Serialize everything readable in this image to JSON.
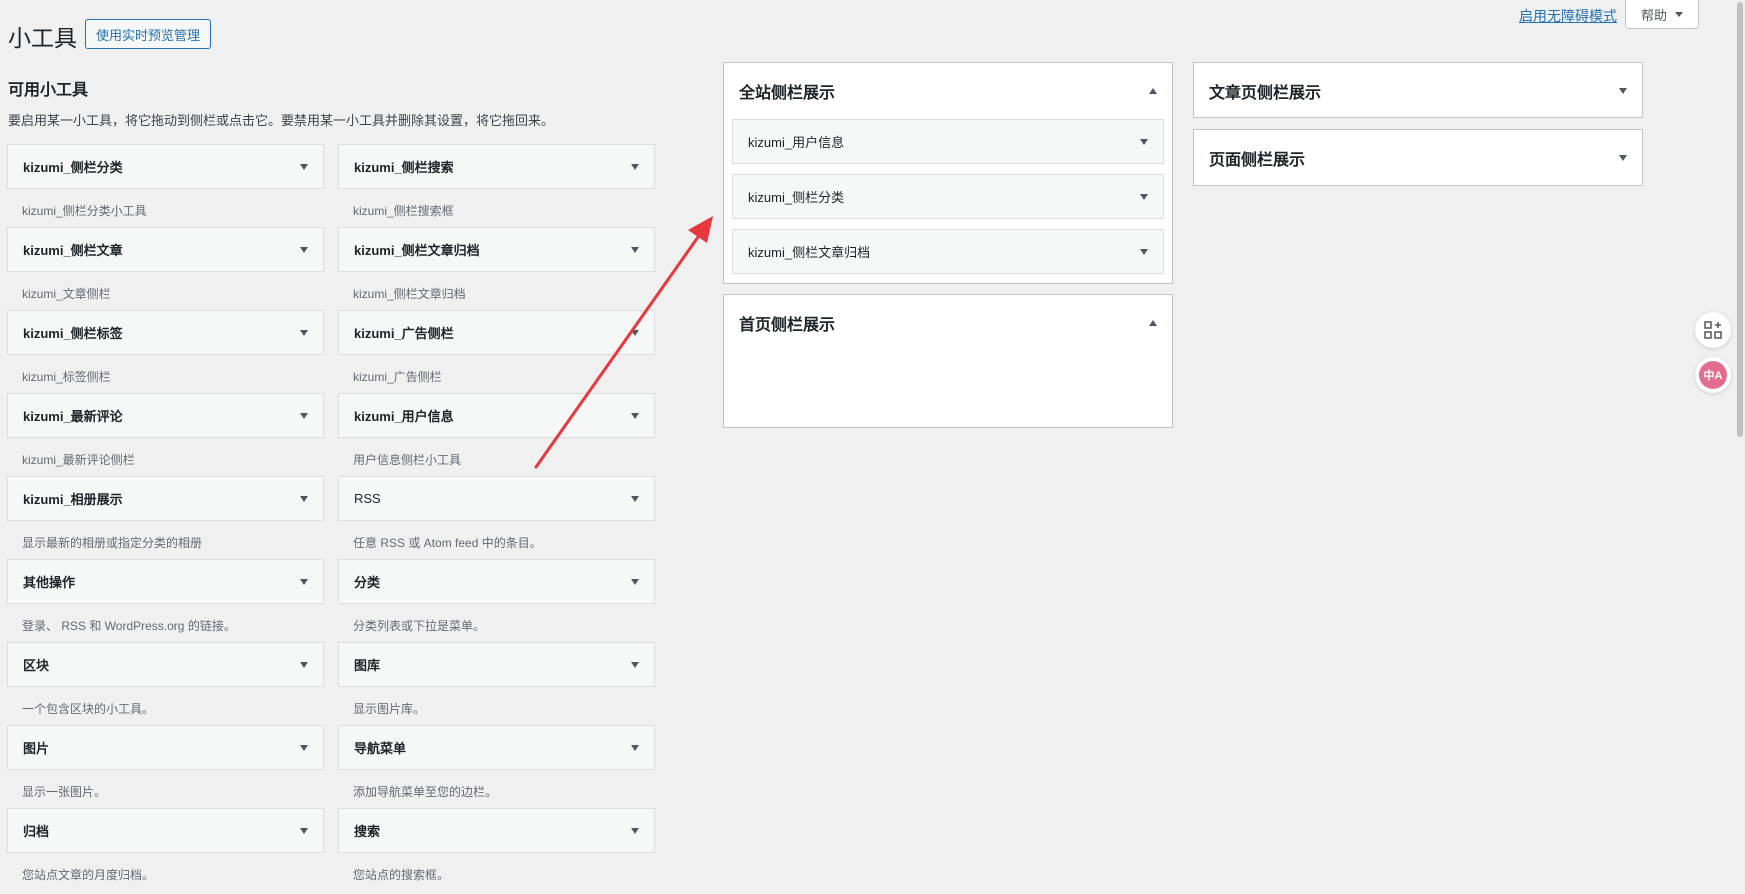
{
  "header": {
    "title": "小工具",
    "live_preview_button": "使用实时预览管理",
    "accessibility_link": "启用无障碍模式",
    "help_button": "帮助"
  },
  "available": {
    "title": "可用小工具",
    "description": "要启用某一小工具，将它拖动到侧栏或点击它。要禁用某一小工具并删除其设置，将它拖回来。",
    "widgets": [
      {
        "label": "kizumi_侧栏分类",
        "desc": "kizumi_侧栏分类小工具"
      },
      {
        "label": "kizumi_侧栏搜索",
        "desc": "kizumi_侧栏搜索框"
      },
      {
        "label": "kizumi_侧栏文章",
        "desc": "kizumi_文章侧栏"
      },
      {
        "label": "kizumi_侧栏文章归档",
        "desc": "kizumi_侧栏文章归档"
      },
      {
        "label": "kizumi_侧栏标签",
        "desc": "kizumi_标签侧栏"
      },
      {
        "label": "kizumi_广告侧栏",
        "desc": "kizumi_广告侧栏"
      },
      {
        "label": "kizumi_最新评论",
        "desc": "kizumi_最新评论侧栏"
      },
      {
        "label": "kizumi_用户信息",
        "desc": "用户信息侧栏小工具"
      },
      {
        "label": "kizumi_相册展示",
        "desc": "显示最新的相册或指定分类的相册"
      },
      {
        "label": "RSS",
        "desc": "任意 RSS 或 Atom feed 中的条目。"
      },
      {
        "label": "其他操作",
        "desc": "登录、 RSS 和 WordPress.org 的链接。"
      },
      {
        "label": "分类",
        "desc": "分类列表或下拉是菜单。"
      },
      {
        "label": "区块",
        "desc": "一个包含区块的小工具。"
      },
      {
        "label": "图库",
        "desc": "显示图片库。"
      },
      {
        "label": "图片",
        "desc": "显示一张图片。"
      },
      {
        "label": "导航菜单",
        "desc": "添加导航菜单至您的边栏。"
      },
      {
        "label": "归档",
        "desc": "您站点文章的月度归档。"
      },
      {
        "label": "搜索",
        "desc": "您站点的搜索框。"
      }
    ]
  },
  "areas": {
    "site": {
      "title": "全站侧栏展示",
      "widgets": [
        "kizumi_用户信息",
        "kizumi_侧栏分类",
        "kizumi_侧栏文章归档"
      ]
    },
    "home": {
      "title": "首页侧栏展示"
    },
    "article": {
      "title": "文章页侧栏展示"
    },
    "page": {
      "title": "页面侧栏展示"
    }
  },
  "side_tools": {
    "translate_label": "中A"
  },
  "colors": {
    "accent": "#2271b1",
    "annotation": "#e8383d"
  }
}
